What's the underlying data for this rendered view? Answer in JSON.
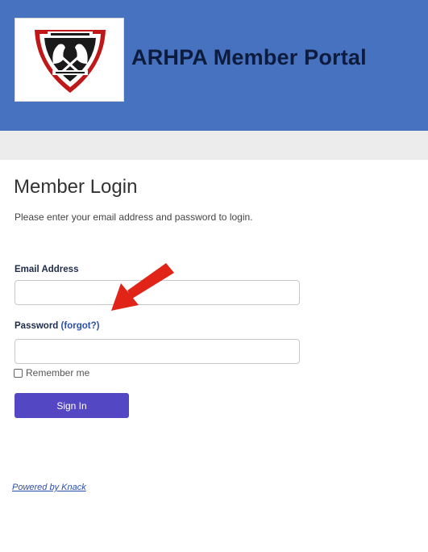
{
  "header": {
    "title": "ARHPA Member Portal",
    "background_color": "#4772c0",
    "logo_icon": "arhpa-shield-logo"
  },
  "login": {
    "heading": "Member Login",
    "instructions": "Please enter your email address and password to login.",
    "email_label": "Email Address",
    "email_value": "",
    "password_label": "Password",
    "forgot_label": "(forgot?)",
    "password_value": "",
    "remember_label": "Remember me",
    "remember_checked": false,
    "submit_label": "Sign In",
    "submit_color": "#5447c4"
  },
  "footer": {
    "powered_by": "Powered by Knack"
  },
  "annotation": {
    "arrow_icon": "red-arrow-icon",
    "arrow_color": "#e02418"
  }
}
